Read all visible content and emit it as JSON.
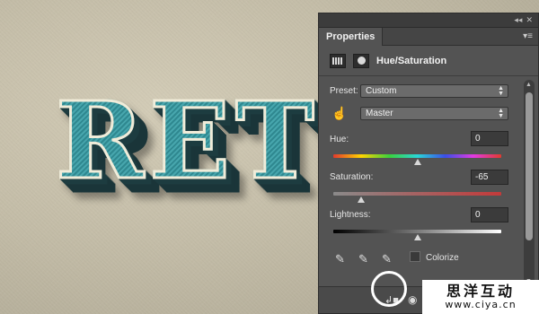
{
  "canvas": {
    "text": "RET"
  },
  "panel": {
    "collapse_glyph": "◂◂",
    "close_glyph": "✕",
    "tab_label": "Properties",
    "menu_glyph": "▾≡",
    "title": "Hue/Saturation",
    "preset": {
      "label": "Preset:",
      "value": "Custom"
    },
    "channel": {
      "value": "Master"
    },
    "hue": {
      "label": "Hue:",
      "value": "0"
    },
    "saturation": {
      "label": "Saturation:",
      "value": "-65"
    },
    "lightness": {
      "label": "Lightness:",
      "value": "0"
    },
    "colorize_label": "Colorize",
    "icons": {
      "targeted_adjust": "hand-icon",
      "eyedropper": "eyedropper-icon",
      "eyedropper_plus": "eyedropper-plus-icon",
      "eyedropper_minus": "eyedropper-minus-icon",
      "clip": "clip-to-layer-icon",
      "visibility": "eye-icon"
    }
  },
  "watermark": {
    "name": "思洋互动",
    "url": "www.ciya.cn"
  }
}
